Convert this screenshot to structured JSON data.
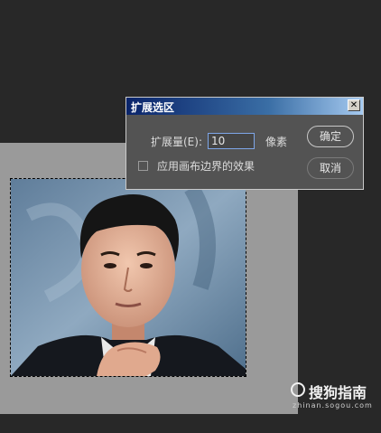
{
  "dialog": {
    "title": "扩展选区",
    "close_glyph": "✕",
    "expand_label": "扩展量(E):",
    "expand_value": "10",
    "unit": "像素",
    "apply_canvas_label": "应用画布边界的效果",
    "apply_canvas_checked": false,
    "ok_label": "确定",
    "cancel_label": "取消"
  },
  "watermark": {
    "brand": "搜狗指南",
    "url": "zhinan.sogou.com"
  },
  "colors": {
    "workspace": "#282828",
    "canvas": "#9a9a9a",
    "dialog": "#535353",
    "title_bar": "#0a246a"
  }
}
